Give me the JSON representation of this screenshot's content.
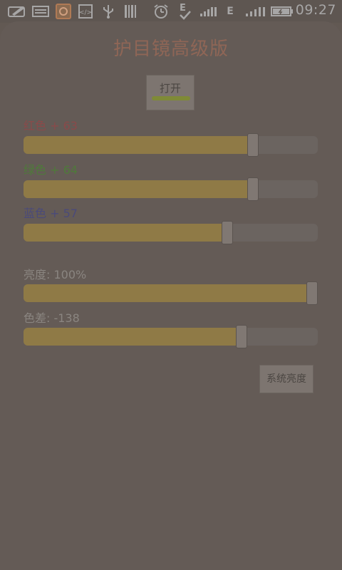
{
  "status_bar": {
    "time": "09:27",
    "network_label": "E",
    "icons": [
      "pencil-icon",
      "keyboard-icon",
      "app-icon",
      "code-icon",
      "usb-icon",
      "barcode-icon",
      "alarm-icon",
      "e-check-icon",
      "signal-icon",
      "signal-icon-2",
      "battery-icon"
    ]
  },
  "app": {
    "title": "护目镜高级版",
    "toggle_label": "打开",
    "toggle_on": true,
    "system_brightness_label": "系统亮度"
  },
  "sliders": {
    "red": {
      "label": "红色 + 63",
      "value": 0.79,
      "color": "#8a4a4a"
    },
    "green": {
      "label": "绿色 + 64",
      "value": 0.79,
      "color": "#4f7a3a"
    },
    "blue": {
      "label": "蓝色 + 57",
      "value": 0.7,
      "color": "#4a4a7a"
    },
    "brightness": {
      "label": "亮度: 100%",
      "value": 1.0
    },
    "color_difference": {
      "label": "色差: -138",
      "value": 0.75
    }
  },
  "colors": {
    "overlay": "#625953",
    "slider_fill": "#8f7a46",
    "title": "#8f6656"
  }
}
